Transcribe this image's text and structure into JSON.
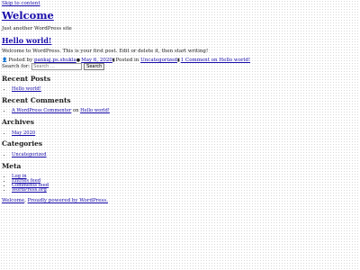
{
  "skip_link": "Skip to content",
  "site": {
    "title": "Welcome",
    "tagline": "Just another WordPress site"
  },
  "post": {
    "title": "Hello world!",
    "body": "Welcome to WordPress. This is your first post. Edit or delete it, then start writing!",
    "meta": {
      "posted_by": "Posted by",
      "author": "pankaj.ps.shukla",
      "date": "May 6, 2020",
      "posted_in": "Posted in",
      "category": "Uncategorized",
      "comments": "1 Comment on Hello world!"
    }
  },
  "search": {
    "label": "Search for:",
    "placeholder": "Search …",
    "button": "Search"
  },
  "widgets": {
    "recent_posts": {
      "title": "Recent Posts",
      "items": [
        "Hello world!"
      ]
    },
    "recent_comments": {
      "title": "Recent Comments",
      "author": "A WordPress Commenter",
      "on": "on",
      "post": "Hello world!"
    },
    "archives": {
      "title": "Archives",
      "items": [
        "May 2020"
      ]
    },
    "categories": {
      "title": "Categories",
      "items": [
        "Uncategorized"
      ]
    },
    "meta": {
      "title": "Meta",
      "items": [
        "Log in",
        "Entries feed",
        "Comments feed",
        "WordPress.org"
      ]
    }
  },
  "footer": {
    "site": "Welcome",
    "sep": ", ",
    "powered": "Proudly powered by WordPress."
  }
}
